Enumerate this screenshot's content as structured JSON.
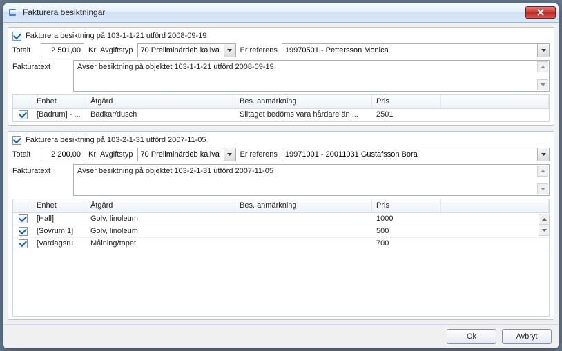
{
  "window": {
    "title": "Fakturera besiktningar"
  },
  "columns": {
    "enhet": "Enhet",
    "atgard": "Åtgärd",
    "anmarkning": "Bes. anmärkning",
    "pris": "Pris"
  },
  "labels": {
    "totalt": "Totalt",
    "kr": "Kr",
    "avgiftstyp": "Avgiftstyp",
    "er_referens": "Er referens",
    "fakturatext": "Fakturatext"
  },
  "buttons": {
    "ok": "Ok",
    "cancel": "Avbryt"
  },
  "panels": [
    {
      "check_label": "Fakturera besiktning på 103-1-1-21 utförd 2008-09-19",
      "totalt": "2 501,00",
      "avgiftstyp": "70 Preliminärdeb kallva",
      "referens": "19970501 -  Pettersson Monica",
      "fakturatext": "Avser besiktning på objektet 103-1-1-21 utförd 2008-09-19",
      "rows": [
        {
          "enhet": "[Badrum] - ...",
          "atgard": "Badkar/dusch",
          "anm": "Slitaget bedöms vara hårdare än ...",
          "pris": "2501"
        }
      ]
    },
    {
      "check_label": "Fakturera besiktning på 103-2-1-31 utförd 2007-11-05",
      "totalt": "2 200,00",
      "avgiftstyp": "70 Preliminärdeb kallva",
      "referens": "19971001 - 20011031 Gustafsson Bora",
      "fakturatext": "Avser besiktning på objektet 103-2-1-31 utförd 2007-11-05",
      "rows": [
        {
          "enhet": "[Hall]",
          "atgard": "Golv, linoleum",
          "anm": "",
          "pris": "1000"
        },
        {
          "enhet": "[Sovrum 1]",
          "atgard": "Golv, linoleum",
          "anm": "",
          "pris": "500"
        },
        {
          "enhet": "[Vardagsru",
          "atgard": "Målning/tapet",
          "anm": "",
          "pris": "700"
        }
      ]
    }
  ]
}
